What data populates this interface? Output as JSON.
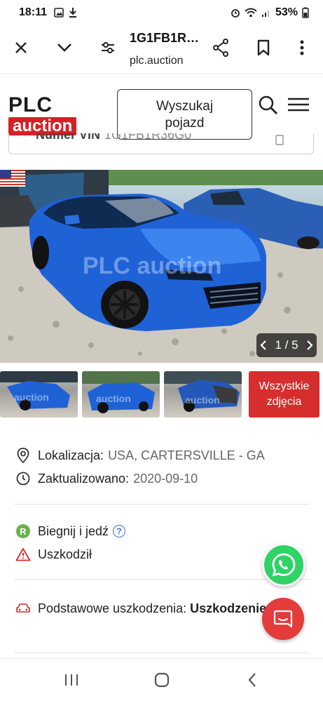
{
  "status_bar": {
    "time": "18:11",
    "battery": "53%"
  },
  "browser": {
    "page_title": "1G1FB1R…",
    "url": "plc.auction"
  },
  "site": {
    "logo_top": "PLC",
    "logo_bottom": "auction",
    "search_button_line1": "Wyszukaj",
    "search_button_line2": "pojazd",
    "vin_label": "Numer VIN",
    "vin_value": "1G1FB1R36G0"
  },
  "gallery": {
    "watermark": "PLC auction",
    "counter": "1 / 5",
    "thumb_watermark": "auction",
    "all_photos_line1": "Wszystkie",
    "all_photos_line2": "zdjęcia",
    "accent_color": "#d62d2d"
  },
  "details": {
    "location_label": "Lokalizacja:",
    "location_value": "USA, CARTERSVILLE - GA",
    "updated_label": "Zaktualizowano:",
    "updated_value": "2020-09-10",
    "run_drive_badge": "R",
    "run_drive_label": "Biegnij i jedź",
    "damaged_label": "Uszkodził",
    "primary_damage_label": "Podstawowe uszkodzenia:",
    "primary_damage_value": "Uszkodzenie tyłu"
  },
  "icons": {
    "location": "map-pin-icon",
    "updated": "clock-icon",
    "damaged": "warning-triangle-icon",
    "primary_damage": "car-icon",
    "whatsapp": "whatsapp-icon",
    "chat": "chat-icon"
  }
}
